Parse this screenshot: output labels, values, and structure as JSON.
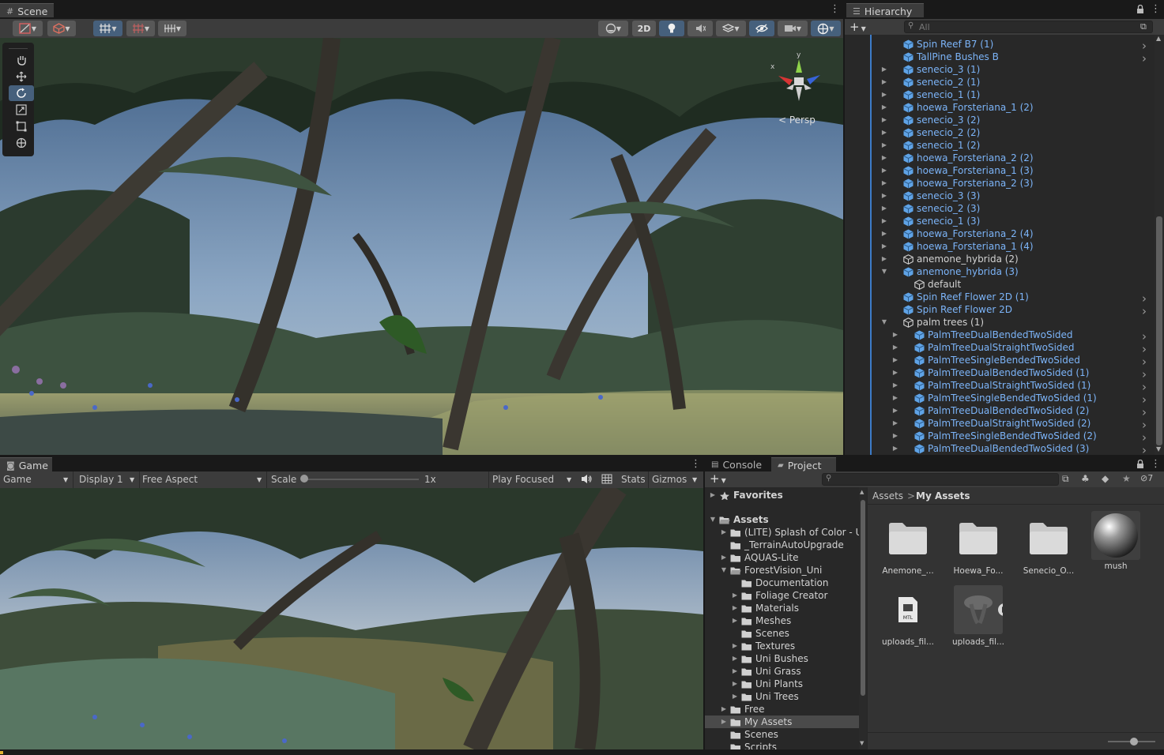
{
  "scene": {
    "tab_label": "Scene",
    "btn_2d": "2D",
    "persp_label": "< Persp",
    "gizmo_x": "x",
    "gizmo_y": "y"
  },
  "hierarchy": {
    "tab_label": "Hierarchy",
    "search_placeholder": "All",
    "items": [
      {
        "label": "Spin Reef B7 (1)",
        "indent": 1,
        "color": "blue",
        "icon": "prefab-cube-icon",
        "expand": "none",
        "chevron": true
      },
      {
        "label": "TallPine Bushes B",
        "indent": 1,
        "color": "blue",
        "icon": "prefab-cube-icon",
        "expand": "none",
        "chevron": true
      },
      {
        "label": "senecio_3 (1)",
        "indent": 1,
        "color": "blue",
        "icon": "prefab-cube-icon",
        "expand": "collapsed",
        "chevron": false
      },
      {
        "label": "senecio_2 (1)",
        "indent": 1,
        "color": "blue",
        "icon": "prefab-cube-icon",
        "expand": "collapsed",
        "chevron": false
      },
      {
        "label": "senecio_1 (1)",
        "indent": 1,
        "color": "blue",
        "icon": "prefab-cube-icon",
        "expand": "collapsed",
        "chevron": false
      },
      {
        "label": "hoewa_Forsteriana_1 (2)",
        "indent": 1,
        "color": "blue",
        "icon": "prefab-cube-icon",
        "expand": "collapsed",
        "chevron": false
      },
      {
        "label": "senecio_3 (2)",
        "indent": 1,
        "color": "blue",
        "icon": "prefab-cube-icon",
        "expand": "collapsed",
        "chevron": false
      },
      {
        "label": "senecio_2 (2)",
        "indent": 1,
        "color": "blue",
        "icon": "prefab-cube-icon",
        "expand": "collapsed",
        "chevron": false
      },
      {
        "label": "senecio_1 (2)",
        "indent": 1,
        "color": "blue",
        "icon": "prefab-cube-icon",
        "expand": "collapsed",
        "chevron": false
      },
      {
        "label": "hoewa_Forsteriana_2 (2)",
        "indent": 1,
        "color": "blue",
        "icon": "prefab-cube-icon",
        "expand": "collapsed",
        "chevron": false
      },
      {
        "label": "hoewa_Forsteriana_1 (3)",
        "indent": 1,
        "color": "blue",
        "icon": "prefab-cube-icon",
        "expand": "collapsed",
        "chevron": false
      },
      {
        "label": "hoewa_Forsteriana_2 (3)",
        "indent": 1,
        "color": "blue",
        "icon": "prefab-cube-icon",
        "expand": "collapsed",
        "chevron": false
      },
      {
        "label": "senecio_3 (3)",
        "indent": 1,
        "color": "blue",
        "icon": "prefab-cube-icon",
        "expand": "collapsed",
        "chevron": false
      },
      {
        "label": "senecio_2 (3)",
        "indent": 1,
        "color": "blue",
        "icon": "prefab-cube-icon",
        "expand": "collapsed",
        "chevron": false
      },
      {
        "label": "senecio_1 (3)",
        "indent": 1,
        "color": "blue",
        "icon": "prefab-cube-icon",
        "expand": "collapsed",
        "chevron": false
      },
      {
        "label": "hoewa_Forsteriana_2 (4)",
        "indent": 1,
        "color": "blue",
        "icon": "prefab-cube-icon",
        "expand": "collapsed",
        "chevron": false
      },
      {
        "label": "hoewa_Forsteriana_1 (4)",
        "indent": 1,
        "color": "blue",
        "icon": "prefab-cube-icon",
        "expand": "collapsed",
        "chevron": false
      },
      {
        "label": "anemone_hybrida (2)",
        "indent": 1,
        "color": "white",
        "icon": "gameobject-cube-icon",
        "expand": "collapsed",
        "chevron": false
      },
      {
        "label": "anemone_hybrida (3)",
        "indent": 1,
        "color": "blue",
        "icon": "prefab-cube-icon",
        "expand": "expanded",
        "chevron": false
      },
      {
        "label": "default",
        "indent": 2,
        "color": "white",
        "icon": "gameobject-cube-icon",
        "expand": "none",
        "chevron": false
      },
      {
        "label": "Spin Reef Flower 2D (1)",
        "indent": 1,
        "color": "blue",
        "icon": "prefab-cube-icon",
        "expand": "none",
        "chevron": true
      },
      {
        "label": "Spin Reef Flower 2D",
        "indent": 1,
        "color": "blue",
        "icon": "prefab-cube-icon",
        "expand": "none",
        "chevron": true
      },
      {
        "label": "palm trees (1)",
        "indent": 1,
        "color": "white",
        "icon": "gameobject-cube-icon",
        "expand": "expanded",
        "chevron": false
      },
      {
        "label": "PalmTreeDualBendedTwoSided",
        "indent": 2,
        "color": "blue",
        "icon": "prefab-cube-icon",
        "expand": "collapsed",
        "chevron": true
      },
      {
        "label": "PalmTreeDualStraightTwoSided",
        "indent": 2,
        "color": "blue",
        "icon": "prefab-cube-icon",
        "expand": "collapsed",
        "chevron": true
      },
      {
        "label": "PalmTreeSingleBendedTwoSided",
        "indent": 2,
        "color": "blue",
        "icon": "prefab-cube-icon",
        "expand": "collapsed",
        "chevron": true
      },
      {
        "label": "PalmTreeDualBendedTwoSided (1)",
        "indent": 2,
        "color": "blue",
        "icon": "prefab-cube-icon",
        "expand": "collapsed",
        "chevron": true
      },
      {
        "label": "PalmTreeDualStraightTwoSided (1)",
        "indent": 2,
        "color": "blue",
        "icon": "prefab-cube-icon",
        "expand": "collapsed",
        "chevron": true
      },
      {
        "label": "PalmTreeSingleBendedTwoSided (1)",
        "indent": 2,
        "color": "blue",
        "icon": "prefab-cube-icon",
        "expand": "collapsed",
        "chevron": true
      },
      {
        "label": "PalmTreeDualBendedTwoSided (2)",
        "indent": 2,
        "color": "blue",
        "icon": "prefab-cube-icon",
        "expand": "collapsed",
        "chevron": true
      },
      {
        "label": "PalmTreeDualStraightTwoSided (2)",
        "indent": 2,
        "color": "blue",
        "icon": "prefab-cube-icon",
        "expand": "collapsed",
        "chevron": true
      },
      {
        "label": "PalmTreeSingleBendedTwoSided (2)",
        "indent": 2,
        "color": "blue",
        "icon": "prefab-cube-icon",
        "expand": "collapsed",
        "chevron": true
      },
      {
        "label": "PalmTreeDualBendedTwoSided (3)",
        "indent": 2,
        "color": "blue",
        "icon": "prefab-cube-icon",
        "expand": "collapsed",
        "chevron": true
      }
    ]
  },
  "game": {
    "tab_label": "Game",
    "mode_select": "Game",
    "display_select": "Display 1",
    "aspect_select": "Free Aspect",
    "scale_label": "Scale",
    "scale_value": "1x",
    "scale_slider_fraction": 0.0,
    "play_mode_select": "Play Focused",
    "stats_label": "Stats",
    "gizmos_label": "Gizmos"
  },
  "console": {
    "tab_label": "Console"
  },
  "project": {
    "tab_label": "Project",
    "hidden_count": "7",
    "tree": [
      {
        "label": "Favorites",
        "indent": 0,
        "expand": "collapsed",
        "icon": "star-icon",
        "bold": true
      },
      {
        "label": "Assets",
        "indent": 0,
        "expand": "expanded",
        "icon": "folder-open-icon",
        "bold": true
      },
      {
        "label": "(LITE) Splash of Color - Ur",
        "indent": 1,
        "expand": "collapsed",
        "icon": "folder-icon",
        "bold": false
      },
      {
        "label": "_TerrainAutoUpgrade",
        "indent": 1,
        "expand": "none",
        "icon": "folder-icon",
        "bold": false
      },
      {
        "label": "AQUAS-Lite",
        "indent": 1,
        "expand": "collapsed",
        "icon": "folder-icon",
        "bold": false
      },
      {
        "label": "ForestVision_Uni",
        "indent": 1,
        "expand": "expanded",
        "icon": "folder-open-icon",
        "bold": false
      },
      {
        "label": "Documentation",
        "indent": 2,
        "expand": "none",
        "icon": "folder-icon",
        "bold": false
      },
      {
        "label": "Foliage Creator",
        "indent": 2,
        "expand": "collapsed",
        "icon": "folder-icon",
        "bold": false
      },
      {
        "label": "Materials",
        "indent": 2,
        "expand": "collapsed",
        "icon": "folder-icon",
        "bold": false
      },
      {
        "label": "Meshes",
        "indent": 2,
        "expand": "collapsed",
        "icon": "folder-icon",
        "bold": false
      },
      {
        "label": "Scenes",
        "indent": 2,
        "expand": "none",
        "icon": "folder-icon",
        "bold": false
      },
      {
        "label": "Textures",
        "indent": 2,
        "expand": "collapsed",
        "icon": "folder-icon",
        "bold": false
      },
      {
        "label": "Uni Bushes",
        "indent": 2,
        "expand": "collapsed",
        "icon": "folder-icon",
        "bold": false
      },
      {
        "label": "Uni Grass",
        "indent": 2,
        "expand": "collapsed",
        "icon": "folder-icon",
        "bold": false
      },
      {
        "label": "Uni Plants",
        "indent": 2,
        "expand": "collapsed",
        "icon": "folder-icon",
        "bold": false
      },
      {
        "label": "Uni Trees",
        "indent": 2,
        "expand": "collapsed",
        "icon": "folder-icon",
        "bold": false
      },
      {
        "label": "Free",
        "indent": 1,
        "expand": "collapsed",
        "icon": "folder-icon",
        "bold": false
      },
      {
        "label": "My Assets",
        "indent": 1,
        "expand": "collapsed",
        "icon": "folder-icon",
        "bold": false,
        "selected": true
      },
      {
        "label": "Scenes",
        "indent": 1,
        "expand": "none",
        "icon": "folder-icon",
        "bold": false
      },
      {
        "label": "Scripts",
        "indent": 1,
        "expand": "none",
        "icon": "folder-icon",
        "bold": false
      }
    ],
    "breadcrumb_root": "Assets",
    "breadcrumb_sep": ">",
    "breadcrumb_current": "My Assets",
    "assets": [
      {
        "label": "Anemone_...",
        "kind": "folder"
      },
      {
        "label": "Hoewa_Fo...",
        "kind": "folder"
      },
      {
        "label": "Senecio_O...",
        "kind": "folder"
      },
      {
        "label": "mush",
        "kind": "material"
      },
      {
        "label": "uploads_fil...",
        "kind": "mtl"
      },
      {
        "label": "uploads_fil...",
        "kind": "model"
      }
    ],
    "mtl_badge": "MTL"
  }
}
